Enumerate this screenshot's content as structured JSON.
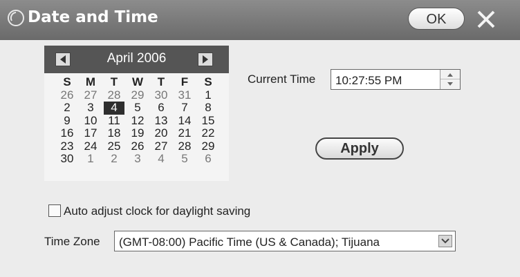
{
  "window": {
    "title": "Date and Time"
  },
  "titlebar": {
    "ok_label": "OK"
  },
  "calendar": {
    "month_label": "April 2006",
    "weekdays": [
      "S",
      "M",
      "T",
      "W",
      "T",
      "F",
      "S"
    ],
    "weeks": [
      [
        [
          "26",
          1
        ],
        [
          "27",
          1
        ],
        [
          "28",
          1
        ],
        [
          "29",
          1
        ],
        [
          "30",
          1
        ],
        [
          "31",
          1
        ],
        [
          "1",
          0
        ]
      ],
      [
        [
          "2",
          0
        ],
        [
          "3",
          0
        ],
        [
          "4",
          2
        ],
        [
          "5",
          0
        ],
        [
          "6",
          0
        ],
        [
          "7",
          0
        ],
        [
          "8",
          0
        ]
      ],
      [
        [
          "9",
          0
        ],
        [
          "10",
          0
        ],
        [
          "11",
          0
        ],
        [
          "12",
          0
        ],
        [
          "13",
          0
        ],
        [
          "14",
          0
        ],
        [
          "15",
          0
        ]
      ],
      [
        [
          "16",
          0
        ],
        [
          "17",
          0
        ],
        [
          "18",
          0
        ],
        [
          "19",
          0
        ],
        [
          "20",
          0
        ],
        [
          "21",
          0
        ],
        [
          "22",
          0
        ]
      ],
      [
        [
          "23",
          0
        ],
        [
          "24",
          0
        ],
        [
          "25",
          0
        ],
        [
          "26",
          0
        ],
        [
          "27",
          0
        ],
        [
          "28",
          0
        ],
        [
          "29",
          0
        ]
      ],
      [
        [
          "30",
          0
        ],
        [
          "1",
          1
        ],
        [
          "2",
          1
        ],
        [
          "3",
          1
        ],
        [
          "4",
          1
        ],
        [
          "5",
          1
        ],
        [
          "6",
          1
        ]
      ]
    ]
  },
  "time": {
    "label": "Current Time",
    "value": "10:27:55 PM"
  },
  "apply": {
    "label": "Apply"
  },
  "daylight": {
    "label": "Auto adjust clock for daylight saving",
    "checked": false
  },
  "timezone": {
    "label": "Time Zone",
    "value": "(GMT-08:00) Pacific Time (US & Canada); Tijuana"
  }
}
